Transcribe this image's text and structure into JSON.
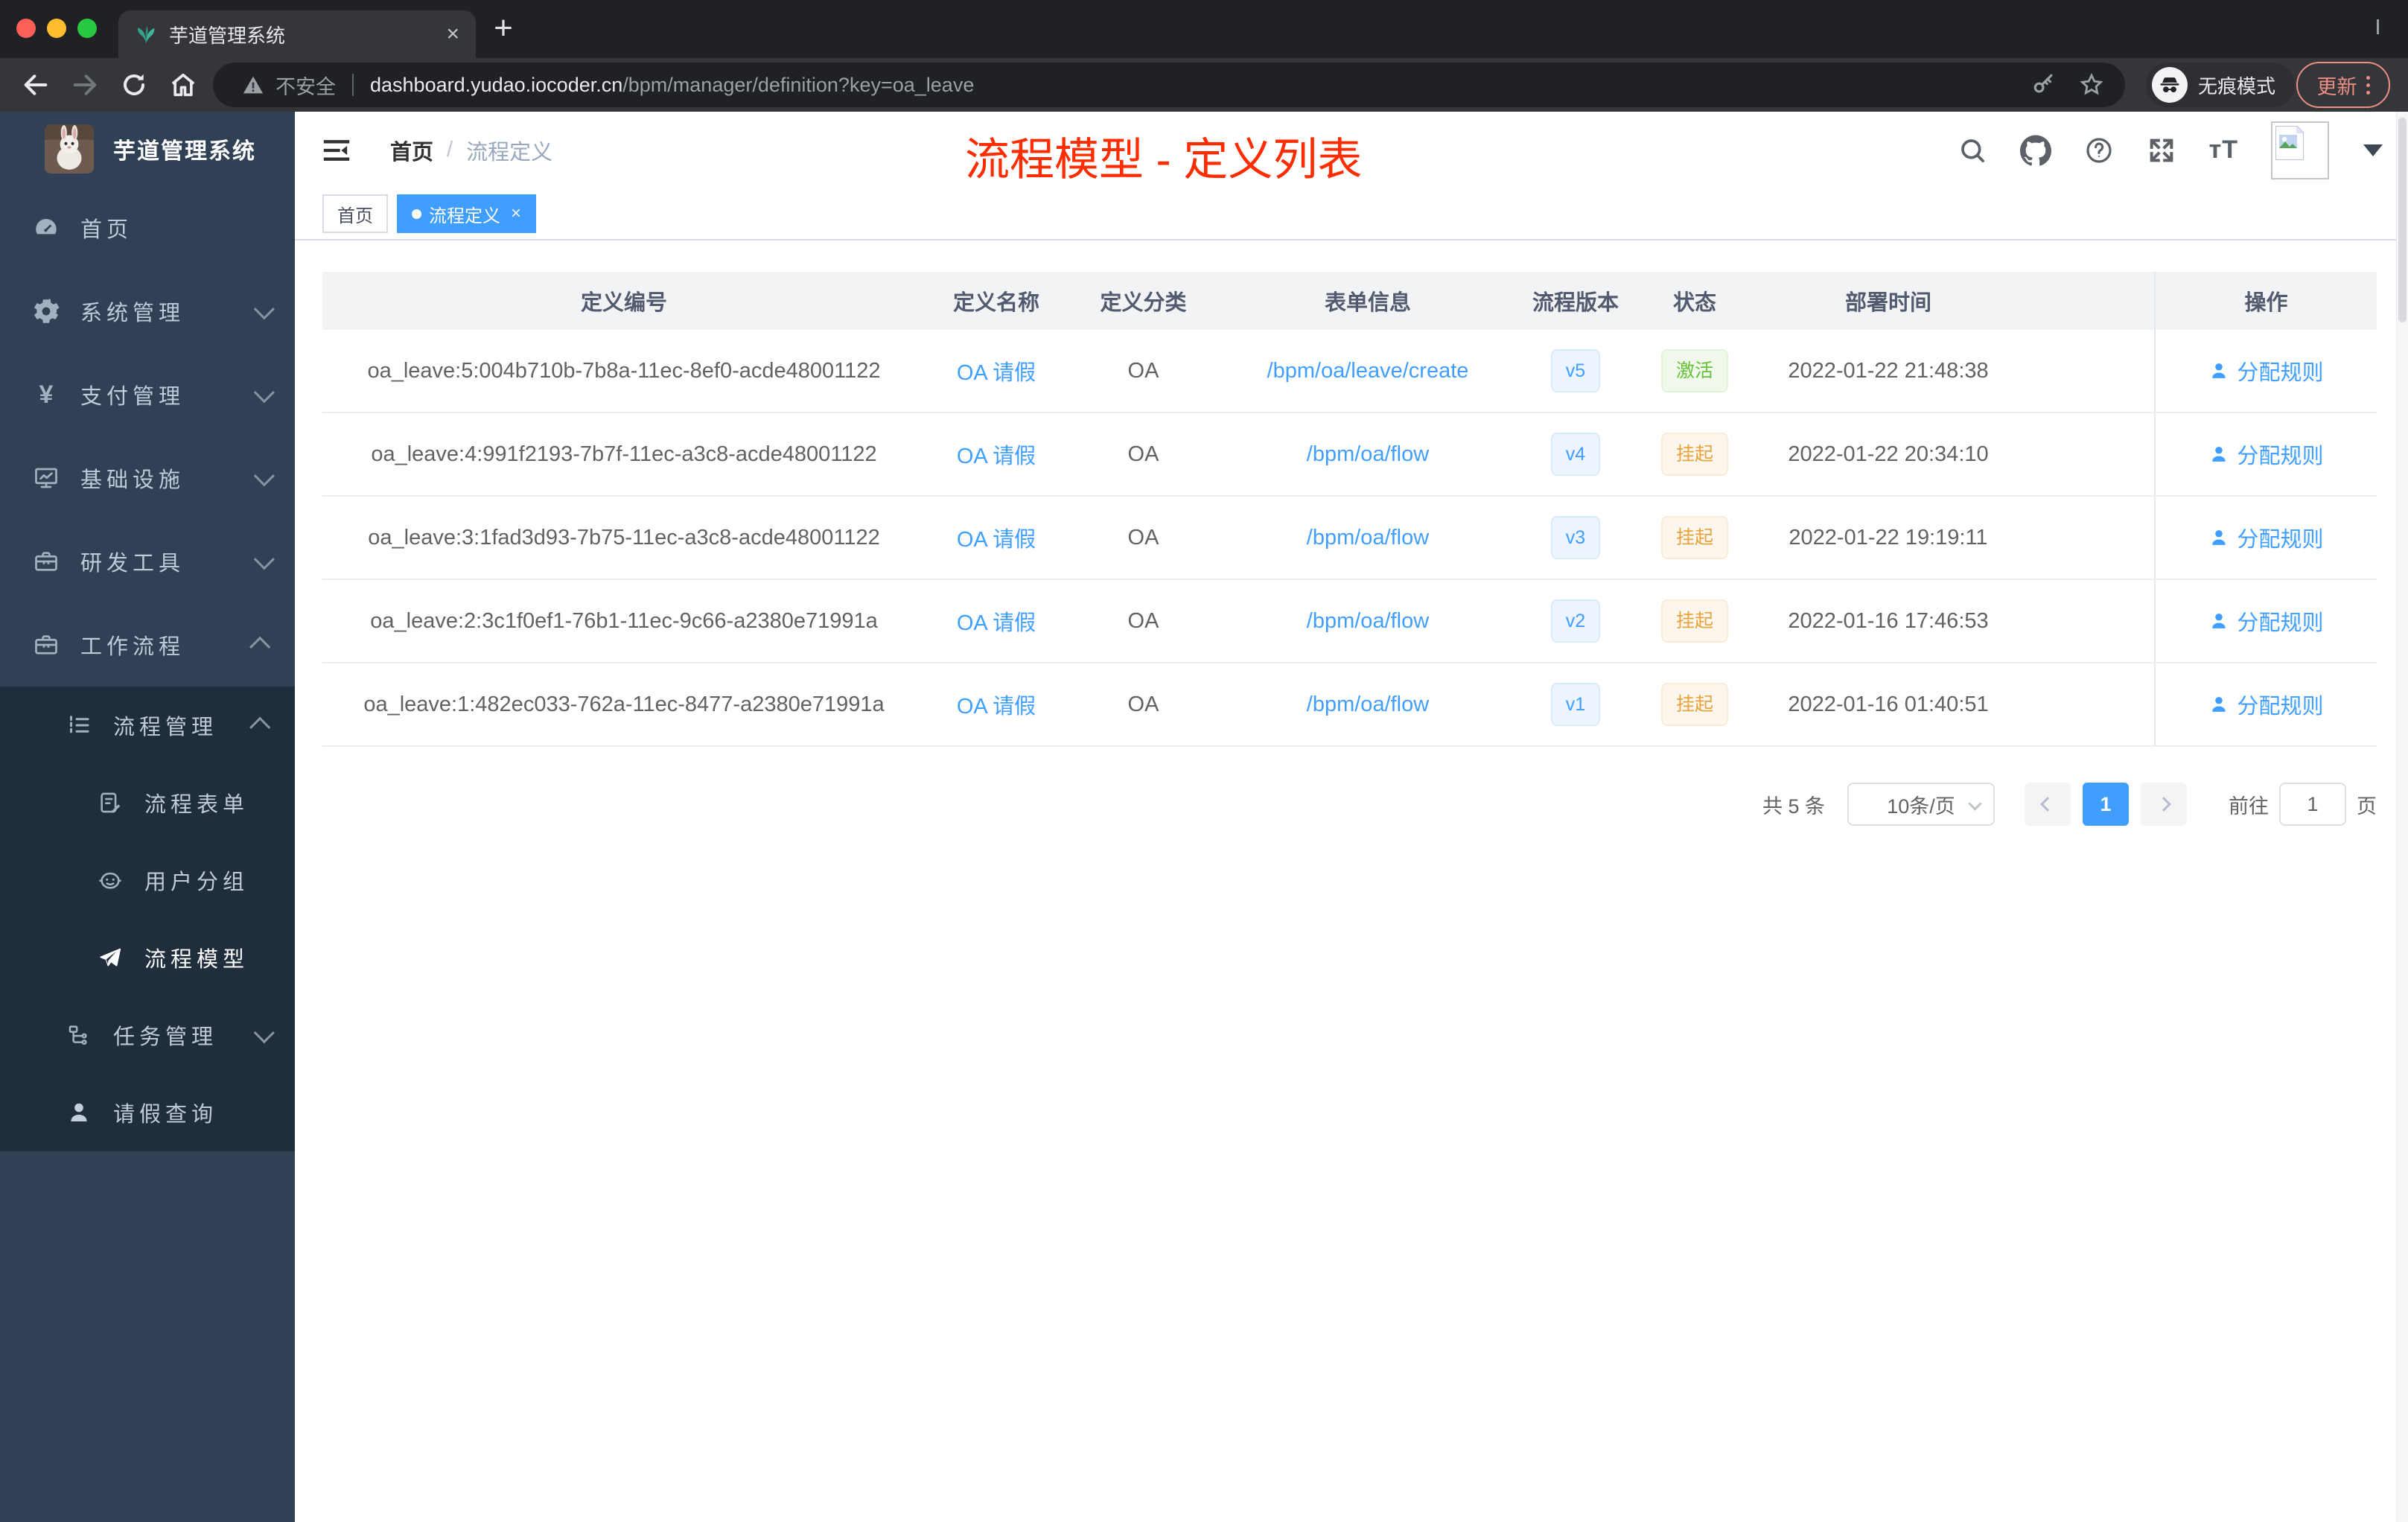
{
  "browser": {
    "tab_title": "芋道管理系统",
    "new_tab_label": "+",
    "security_label": "不安全",
    "url_domain": "dashboard.yudao.iocoder.cn",
    "url_path": "/bpm/manager/definition?key=oa_leave",
    "incognito_label": "无痕模式",
    "update_label": "更新",
    "traffic_colors": {
      "close": "#ff5f57",
      "minimize": "#febc2e",
      "zoom": "#28c840"
    }
  },
  "sidebar": {
    "logo_title": "芋道管理系统",
    "items": [
      {
        "label": "首页"
      },
      {
        "label": "系统管理"
      },
      {
        "label": "支付管理"
      },
      {
        "label": "基础设施"
      },
      {
        "label": "研发工具"
      },
      {
        "label": "工作流程"
      },
      {
        "label": "流程管理"
      },
      {
        "label": "流程表单"
      },
      {
        "label": "用户分组"
      },
      {
        "label": "流程模型"
      },
      {
        "label": "任务管理"
      },
      {
        "label": "请假查询"
      }
    ]
  },
  "header": {
    "breadcrumb": [
      "首页",
      "流程定义"
    ],
    "breadcrumb_separator": "/",
    "annotation": "流程模型 - 定义列表",
    "tags": [
      {
        "label": "首页"
      },
      {
        "label": "流程定义"
      }
    ]
  },
  "table": {
    "headers": [
      "定义编号",
      "定义名称",
      "定义分类",
      "表单信息",
      "流程版本",
      "状态",
      "部署时间",
      "操作"
    ],
    "rows": [
      {
        "id": "oa_leave:5:004b710b-7b8a-11ec-8ef0-acde48001122",
        "name": "OA 请假",
        "category": "OA",
        "form": "/bpm/oa/leave/create",
        "version": "v5",
        "version_type": "info",
        "status": "激活",
        "status_type": "success",
        "time": "2022-01-22 21:48:38",
        "action": "分配规则"
      },
      {
        "id": "oa_leave:4:991f2193-7b7f-11ec-a3c8-acde48001122",
        "name": "OA 请假",
        "category": "OA",
        "form": "/bpm/oa/flow",
        "version": "v4",
        "version_type": "info",
        "status": "挂起",
        "status_type": "warning",
        "time": "2022-01-22 20:34:10",
        "action": "分配规则"
      },
      {
        "id": "oa_leave:3:1fad3d93-7b75-11ec-a3c8-acde48001122",
        "name": "OA 请假",
        "category": "OA",
        "form": "/bpm/oa/flow",
        "version": "v3",
        "version_type": "info",
        "status": "挂起",
        "status_type": "warning",
        "time": "2022-01-22 19:19:11",
        "action": "分配规则"
      },
      {
        "id": "oa_leave:2:3c1f0ef1-76b1-11ec-9c66-a2380e71991a",
        "name": "OA 请假",
        "category": "OA",
        "form": "/bpm/oa/flow",
        "version": "v2",
        "version_type": "info",
        "status": "挂起",
        "status_type": "warning",
        "time": "2022-01-16 17:46:53",
        "action": "分配规则"
      },
      {
        "id": "oa_leave:1:482ec033-762a-11ec-8477-a2380e71991a",
        "name": "OA 请假",
        "category": "OA",
        "form": "/bpm/oa/flow",
        "version": "v1",
        "version_type": "info",
        "status": "挂起",
        "status_type": "warning",
        "time": "2022-01-16 01:40:51",
        "action": "分配规则"
      }
    ]
  },
  "pagination": {
    "total": "共 5 条",
    "page_size": "10条/页",
    "current_page": "1",
    "goto_label": "前往",
    "goto_value": "1",
    "unit_label": "页"
  },
  "colors": {
    "accent": "#409eff",
    "success": "#67c23a",
    "warning": "#e6a23c",
    "annotation_red": "#fe2c01",
    "sidebar_bg": "#304156",
    "submenu_bg": "#1f2d3d"
  }
}
